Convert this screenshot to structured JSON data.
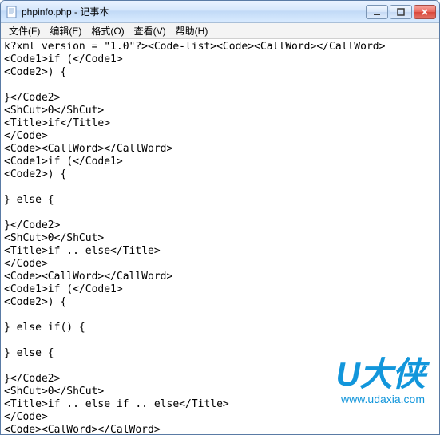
{
  "window": {
    "title": "phpinfo.php - 记事本"
  },
  "menu": {
    "file": "文件(F)",
    "edit": "编辑(E)",
    "format": "格式(O)",
    "view": "查看(V)",
    "help": "帮助(H)"
  },
  "content": {
    "text": "k?xml version = \"1.0\"?><Code-list><Code><CallWord></CallWord>\n<Code1>if (</Code1>\n<Code2>) {\n\n}</Code2>\n<ShCut>0</ShCut>\n<Title>if</Title>\n</Code>\n<Code><CallWord></CallWord>\n<Code1>if (</Code1>\n<Code2>) {\n\n} else {\n\n}</Code2>\n<ShCut>0</ShCut>\n<Title>if .. else</Title>\n</Code>\n<Code><CallWord></CallWord>\n<Code1>if (</Code1>\n<Code2>) {\n\n} else if() {\n\n} else {\n\n}</Code2>\n<ShCut>0</ShCut>\n<Title>if .. else if .. else</Title>\n</Code>\n<Code><CalWord></CalWord>"
  },
  "watermark": {
    "logo": "U大侠",
    "url": "www.udaxia.com"
  }
}
